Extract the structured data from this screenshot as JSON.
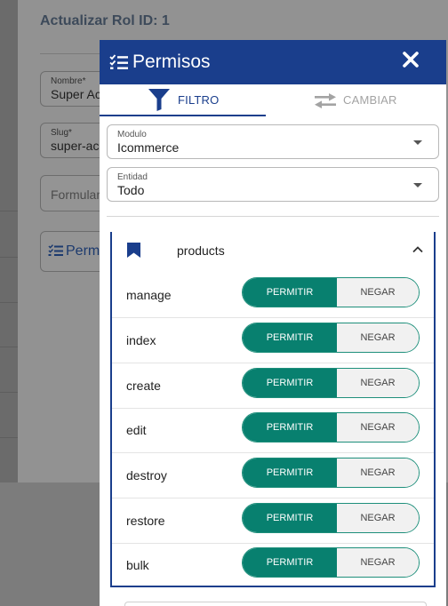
{
  "background": {
    "title": "Actualizar Rol ID: 1",
    "name_field": {
      "label": "Nombre*",
      "value": "Super Ac"
    },
    "slug_field": {
      "label": "Slug*",
      "value": "super-ac"
    },
    "form_field": {
      "placeholder": "Formular"
    },
    "permissions_button": {
      "label": "Perm"
    }
  },
  "modal": {
    "title": "Permisos",
    "tabs": [
      {
        "label": "FILTRO",
        "icon": "filter-icon",
        "active": true
      },
      {
        "label": "CAMBIAR",
        "icon": "swap-arrows-icon",
        "active": false
      }
    ],
    "module_select": {
      "label": "Modulo",
      "value": "Icommerce"
    },
    "entity_select": {
      "label": "Entidad",
      "value": "Todo"
    },
    "group": {
      "name": "products",
      "expanded": true,
      "allow_label": "PERMITIR",
      "deny_label": "NEGAR",
      "permissions": [
        {
          "name": "manage",
          "state": "allow"
        },
        {
          "name": "index",
          "state": "allow"
        },
        {
          "name": "create",
          "state": "allow"
        },
        {
          "name": "edit",
          "state": "allow"
        },
        {
          "name": "destroy",
          "state": "allow"
        },
        {
          "name": "restore",
          "state": "allow"
        },
        {
          "name": "bulk",
          "state": "allow"
        }
      ]
    }
  },
  "colors": {
    "primary": "#1a3e8c",
    "allow_active": "#08806f",
    "deny_inactive": "#f1f1f1"
  }
}
